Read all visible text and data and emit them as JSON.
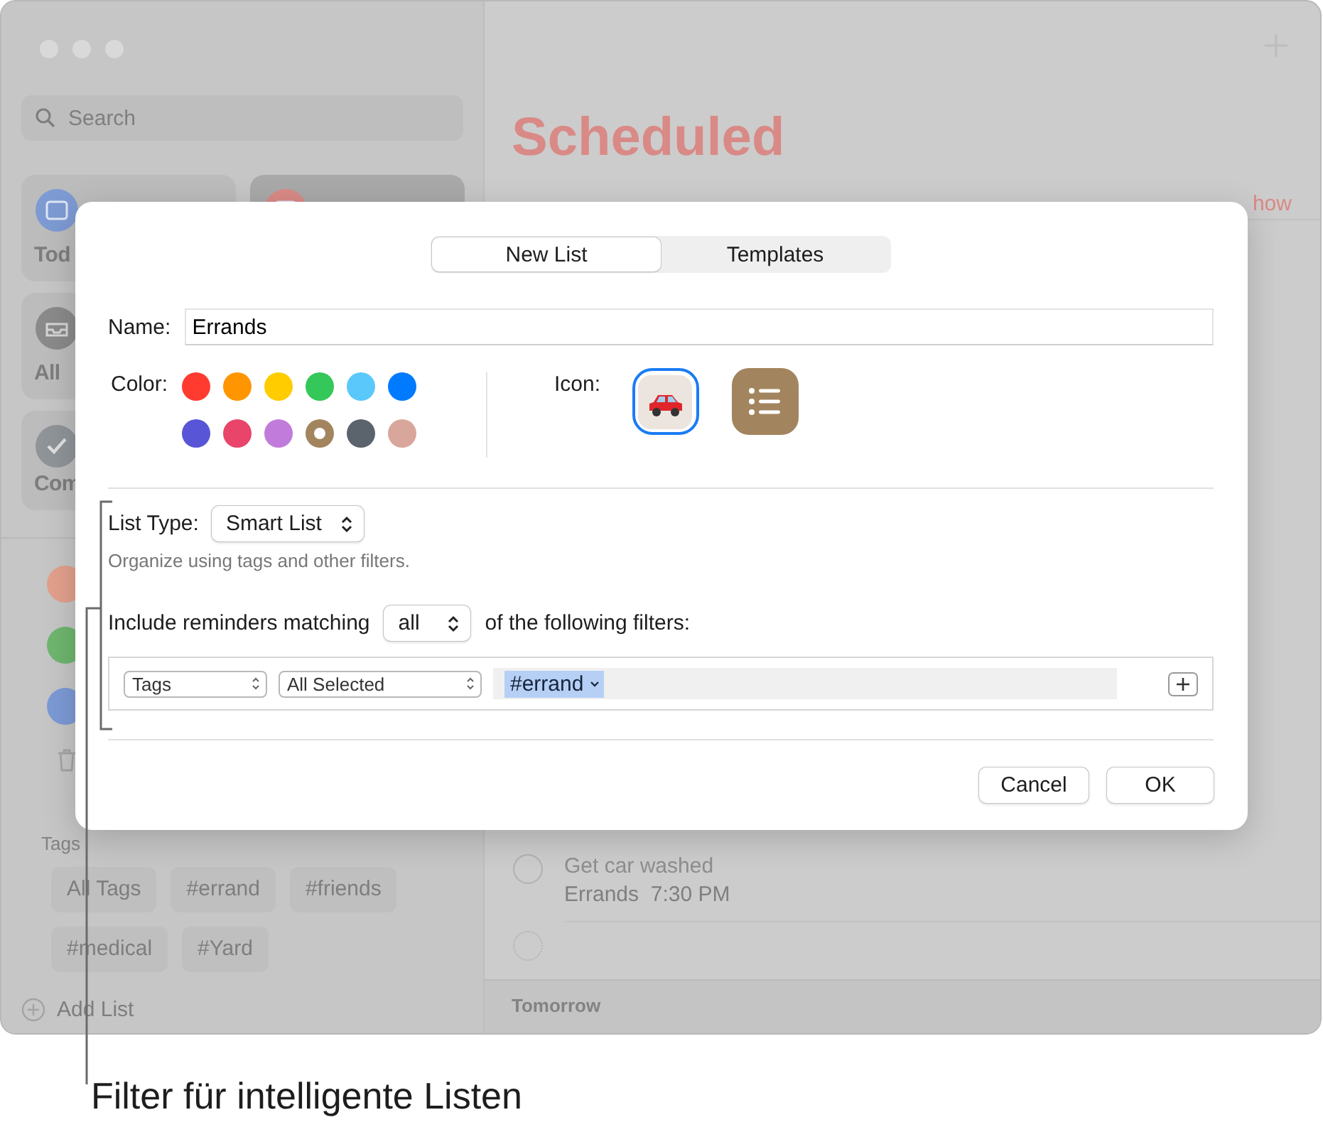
{
  "sidebar": {
    "search": {
      "placeholder": "Search"
    },
    "smart_lists": [
      {
        "kind": "today",
        "label": "Tod",
        "selected": false
      },
      {
        "kind": "scheduled",
        "selected": true
      },
      {
        "kind": "all",
        "label": "All",
        "selected": false
      },
      {
        "kind": "completed",
        "label": "Com",
        "selected": false
      }
    ],
    "lists": [
      {
        "color": "#e2a08c"
      },
      {
        "color": "#6fb56f"
      },
      {
        "color": "#7c9ad6"
      }
    ],
    "tags": {
      "title": "Tags",
      "items": [
        "All Tags",
        "#errand",
        "#friends",
        "#medical",
        "#Yard"
      ]
    },
    "add_list": "Add List"
  },
  "main": {
    "title": "Scheduled",
    "show_link": "how",
    "reminders": [
      {
        "title": "Get car washed",
        "list": "Errands",
        "time": "7:30 PM",
        "checked": false
      }
    ],
    "new_reminder": {
      "checked": false
    },
    "section": "Tomorrow"
  },
  "dialog": {
    "tabs": [
      {
        "label": "New List",
        "selected": true
      },
      {
        "label": "Templates",
        "selected": false
      }
    ],
    "name": {
      "label": "Name:",
      "value": "Errands"
    },
    "color": {
      "label": "Color:",
      "swatches": [
        {
          "color": "#ff3b30",
          "selected": false
        },
        {
          "color": "#ff9500",
          "selected": false
        },
        {
          "color": "#ffcc00",
          "selected": false
        },
        {
          "color": "#34c759",
          "selected": false
        },
        {
          "color": "#5ac8fa",
          "selected": false
        },
        {
          "color": "#007aff",
          "selected": false
        },
        {
          "color": "#5856d6",
          "selected": false
        },
        {
          "color": "#e9446a",
          "selected": false
        },
        {
          "color": "#c17cdb",
          "selected": false
        },
        {
          "color": "#a2845e",
          "selected": true
        },
        {
          "color": "#5b636c",
          "selected": false
        },
        {
          "color": "#d9a69b",
          "selected": false
        }
      ]
    },
    "icon": {
      "label": "Icon:",
      "options": [
        {
          "kind": "car",
          "selected": true
        },
        {
          "kind": "list",
          "selected": false
        }
      ]
    },
    "list_type": {
      "label": "List Type:",
      "value": "Smart List",
      "hint": "Organize using tags and other filters."
    },
    "match": {
      "prefix": "Include reminders matching",
      "value": "all",
      "suffix": "of the following filters:"
    },
    "filter": {
      "field": "Tags",
      "operator": "All Selected",
      "tokens": [
        "#errand"
      ]
    },
    "buttons": {
      "cancel": "Cancel",
      "ok": "OK"
    }
  },
  "annotation": "Filter für intelligente Listen"
}
